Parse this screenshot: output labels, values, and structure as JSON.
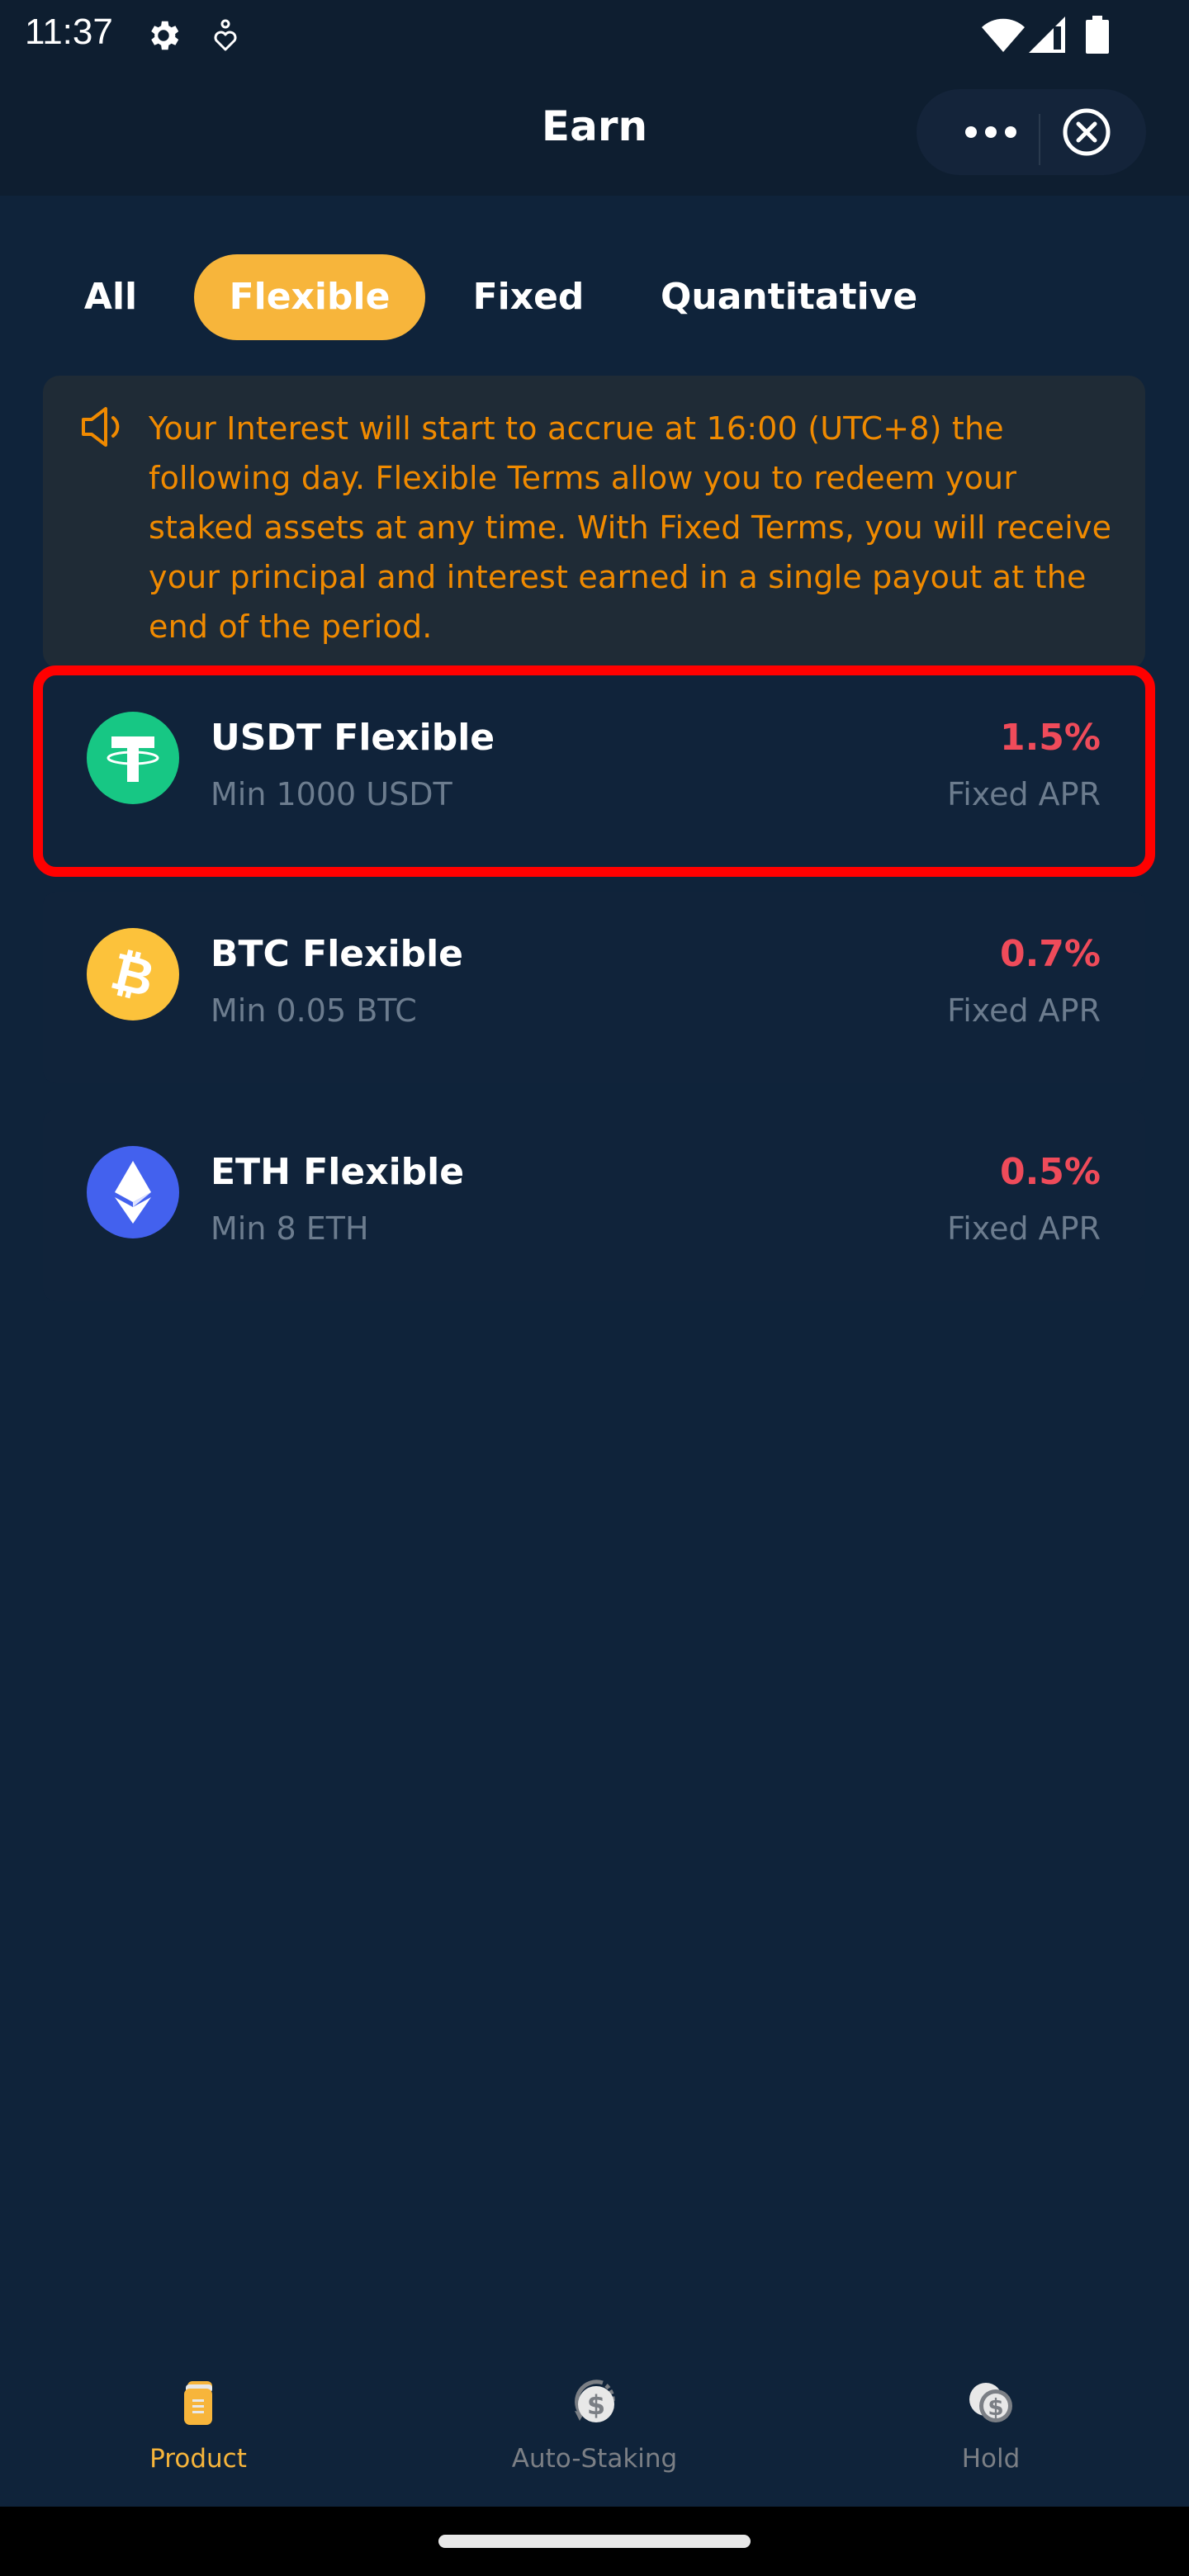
{
  "status_bar": {
    "time": "11:37",
    "left_icons": [
      "gear-icon",
      "accessibility-icon"
    ],
    "right_icons": [
      "wifi-icon",
      "cellular-signal-icon",
      "battery-icon"
    ]
  },
  "header": {
    "title": "Earn",
    "more_icon": "more-dots-icon",
    "close_icon": "close-circle-icon"
  },
  "tabs": [
    {
      "label": "All",
      "active": false
    },
    {
      "label": "Flexible",
      "active": true
    },
    {
      "label": "Fixed",
      "active": false
    },
    {
      "label": "Quantitative",
      "active": false
    }
  ],
  "notice": {
    "icon": "speaker-icon",
    "text": "Your Interest will start to accrue at 16:00 (UTC+8) the following day. Flexible Terms allow you to redeem your staked assets at any time. With Fixed Terms, you will receive your principal and interest earned in a single payout at the end of the period."
  },
  "products": [
    {
      "name": "USDT Flexible",
      "min": "Min 1000 USDT",
      "rate": "1.5%",
      "rate_label": "Fixed APR",
      "coin": "USDT",
      "icon": "tether-icon",
      "highlighted": true
    },
    {
      "name": "BTC Flexible",
      "min": "Min 0.05 BTC",
      "rate": "0.7%",
      "rate_label": "Fixed APR",
      "coin": "BTC",
      "icon": "bitcoin-icon",
      "highlighted": false
    },
    {
      "name": "ETH Flexible",
      "min": "Min 8 ETH",
      "rate": "0.5%",
      "rate_label": "Fixed APR",
      "coin": "ETH",
      "icon": "ethereum-icon",
      "highlighted": false
    }
  ],
  "bottom_nav": [
    {
      "label": "Product",
      "icon": "product-folder-icon",
      "active": true
    },
    {
      "label": "Auto-Staking",
      "icon": "auto-staking-coin-icon",
      "active": false
    },
    {
      "label": "Hold",
      "icon": "hold-coins-icon",
      "active": false
    }
  ],
  "colors": {
    "accent": "#f7b53b",
    "rate": "#ef4b5a",
    "notice_text": "#f08a00",
    "muted_text": "#6c7c8e",
    "nav_inactive": "#7b7f85",
    "highlight_box": "#ff0000",
    "usdt": "#17c784",
    "btc": "#fcc23b",
    "eth": "#4361ee"
  }
}
